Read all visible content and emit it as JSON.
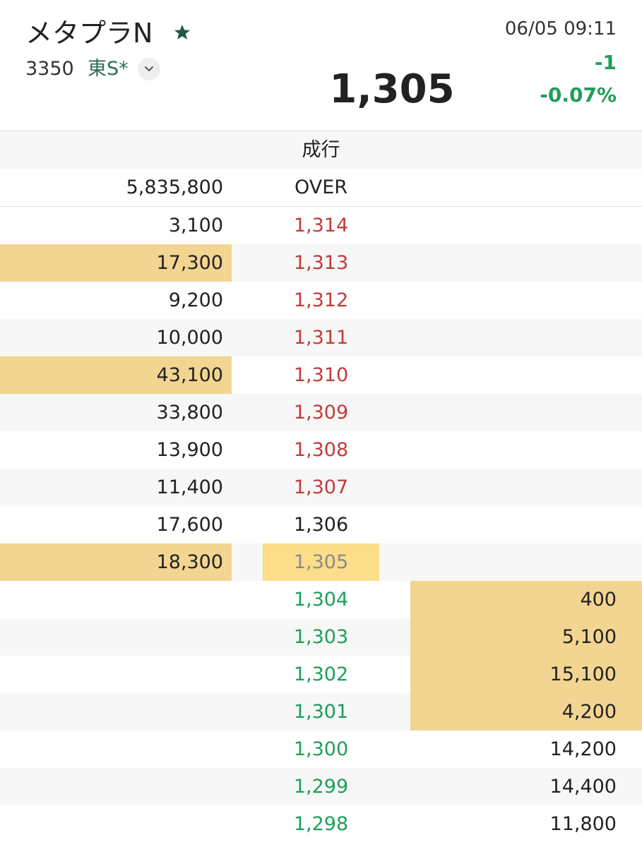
{
  "header": {
    "name": "メタプラN",
    "code": "3350",
    "market": "東S*",
    "timestamp": "06/05 09:11",
    "price": "1,305",
    "change": "-1",
    "change_pct": "-0.07%"
  },
  "icons": {
    "favorite": "star-icon",
    "market_toggle": "chevron-down-icon"
  },
  "colors": {
    "accent_green": "#1f9e5a",
    "up_red": "#c23b3b",
    "highlight": "#f2d591",
    "market_label": "#2e6b54"
  },
  "board": {
    "market_order_label": "成行",
    "over_qty": "5,835,800",
    "over_label": "OVER",
    "rows": [
      {
        "ask": "3,100",
        "price": "1,314",
        "bid": ""
      },
      {
        "ask": "17,300",
        "price": "1,313",
        "bid": ""
      },
      {
        "ask": "9,200",
        "price": "1,312",
        "bid": ""
      },
      {
        "ask": "10,000",
        "price": "1,311",
        "bid": ""
      },
      {
        "ask": "43,100",
        "price": "1,310",
        "bid": ""
      },
      {
        "ask": "33,800",
        "price": "1,309",
        "bid": ""
      },
      {
        "ask": "13,900",
        "price": "1,308",
        "bid": ""
      },
      {
        "ask": "11,400",
        "price": "1,307",
        "bid": ""
      },
      {
        "ask": "17,600",
        "price": "1,306",
        "bid": ""
      },
      {
        "ask": "18,300",
        "price": "1,305",
        "bid": ""
      },
      {
        "ask": "",
        "price": "1,304",
        "bid": "400"
      },
      {
        "ask": "",
        "price": "1,303",
        "bid": "5,100"
      },
      {
        "ask": "",
        "price": "1,302",
        "bid": "15,100"
      },
      {
        "ask": "",
        "price": "1,301",
        "bid": "4,200"
      },
      {
        "ask": "",
        "price": "1,300",
        "bid": "14,200"
      },
      {
        "ask": "",
        "price": "1,299",
        "bid": "14,400"
      },
      {
        "ask": "",
        "price": "1,298",
        "bid": "11,800"
      }
    ]
  }
}
